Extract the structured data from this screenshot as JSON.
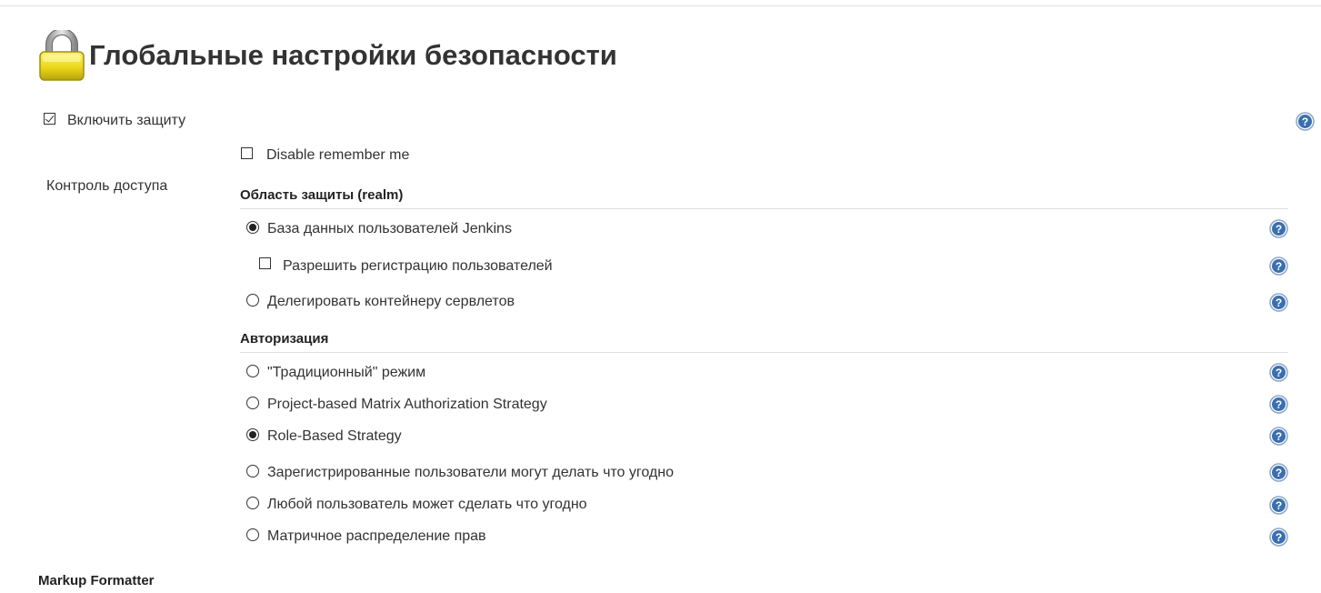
{
  "page": {
    "title": "Глобальные настройки безопасности"
  },
  "security": {
    "enable_label": "Включить защиту",
    "enable_checked": true,
    "disable_remember_label": "Disable remember me",
    "disable_remember_checked": false,
    "access_control_label": "Контроль доступа"
  },
  "realm": {
    "heading": "Область защиты (realm)",
    "options": [
      {
        "label": "База данных пользователей Jenkins",
        "selected": true
      },
      {
        "label": "Делегировать контейнеру сервлетов",
        "selected": false
      }
    ],
    "allow_signup_label": "Разрешить регистрацию пользователей",
    "allow_signup_checked": false
  },
  "authorization": {
    "heading": "Авторизация",
    "options": [
      {
        "label": "\"Традиционный\" режим",
        "selected": false
      },
      {
        "label": "Project-based Matrix Authorization Strategy",
        "selected": false
      },
      {
        "label": "Role-Based Strategy",
        "selected": true
      },
      {
        "label": "Зарегистрированные пользователи могут делать что угодно",
        "selected": false
      },
      {
        "label": "Любой пользователь может сделать что угодно",
        "selected": false
      },
      {
        "label": "Матричное распределение прав",
        "selected": false
      }
    ]
  },
  "markup": {
    "heading": "Markup Formatter"
  },
  "icons": {
    "page_icon": "lock-icon",
    "help_icon": "help-icon"
  },
  "colors": {
    "help_blue": "#3a6fb0",
    "lock_yellow": "#f0e030",
    "separator": "#dedede"
  }
}
